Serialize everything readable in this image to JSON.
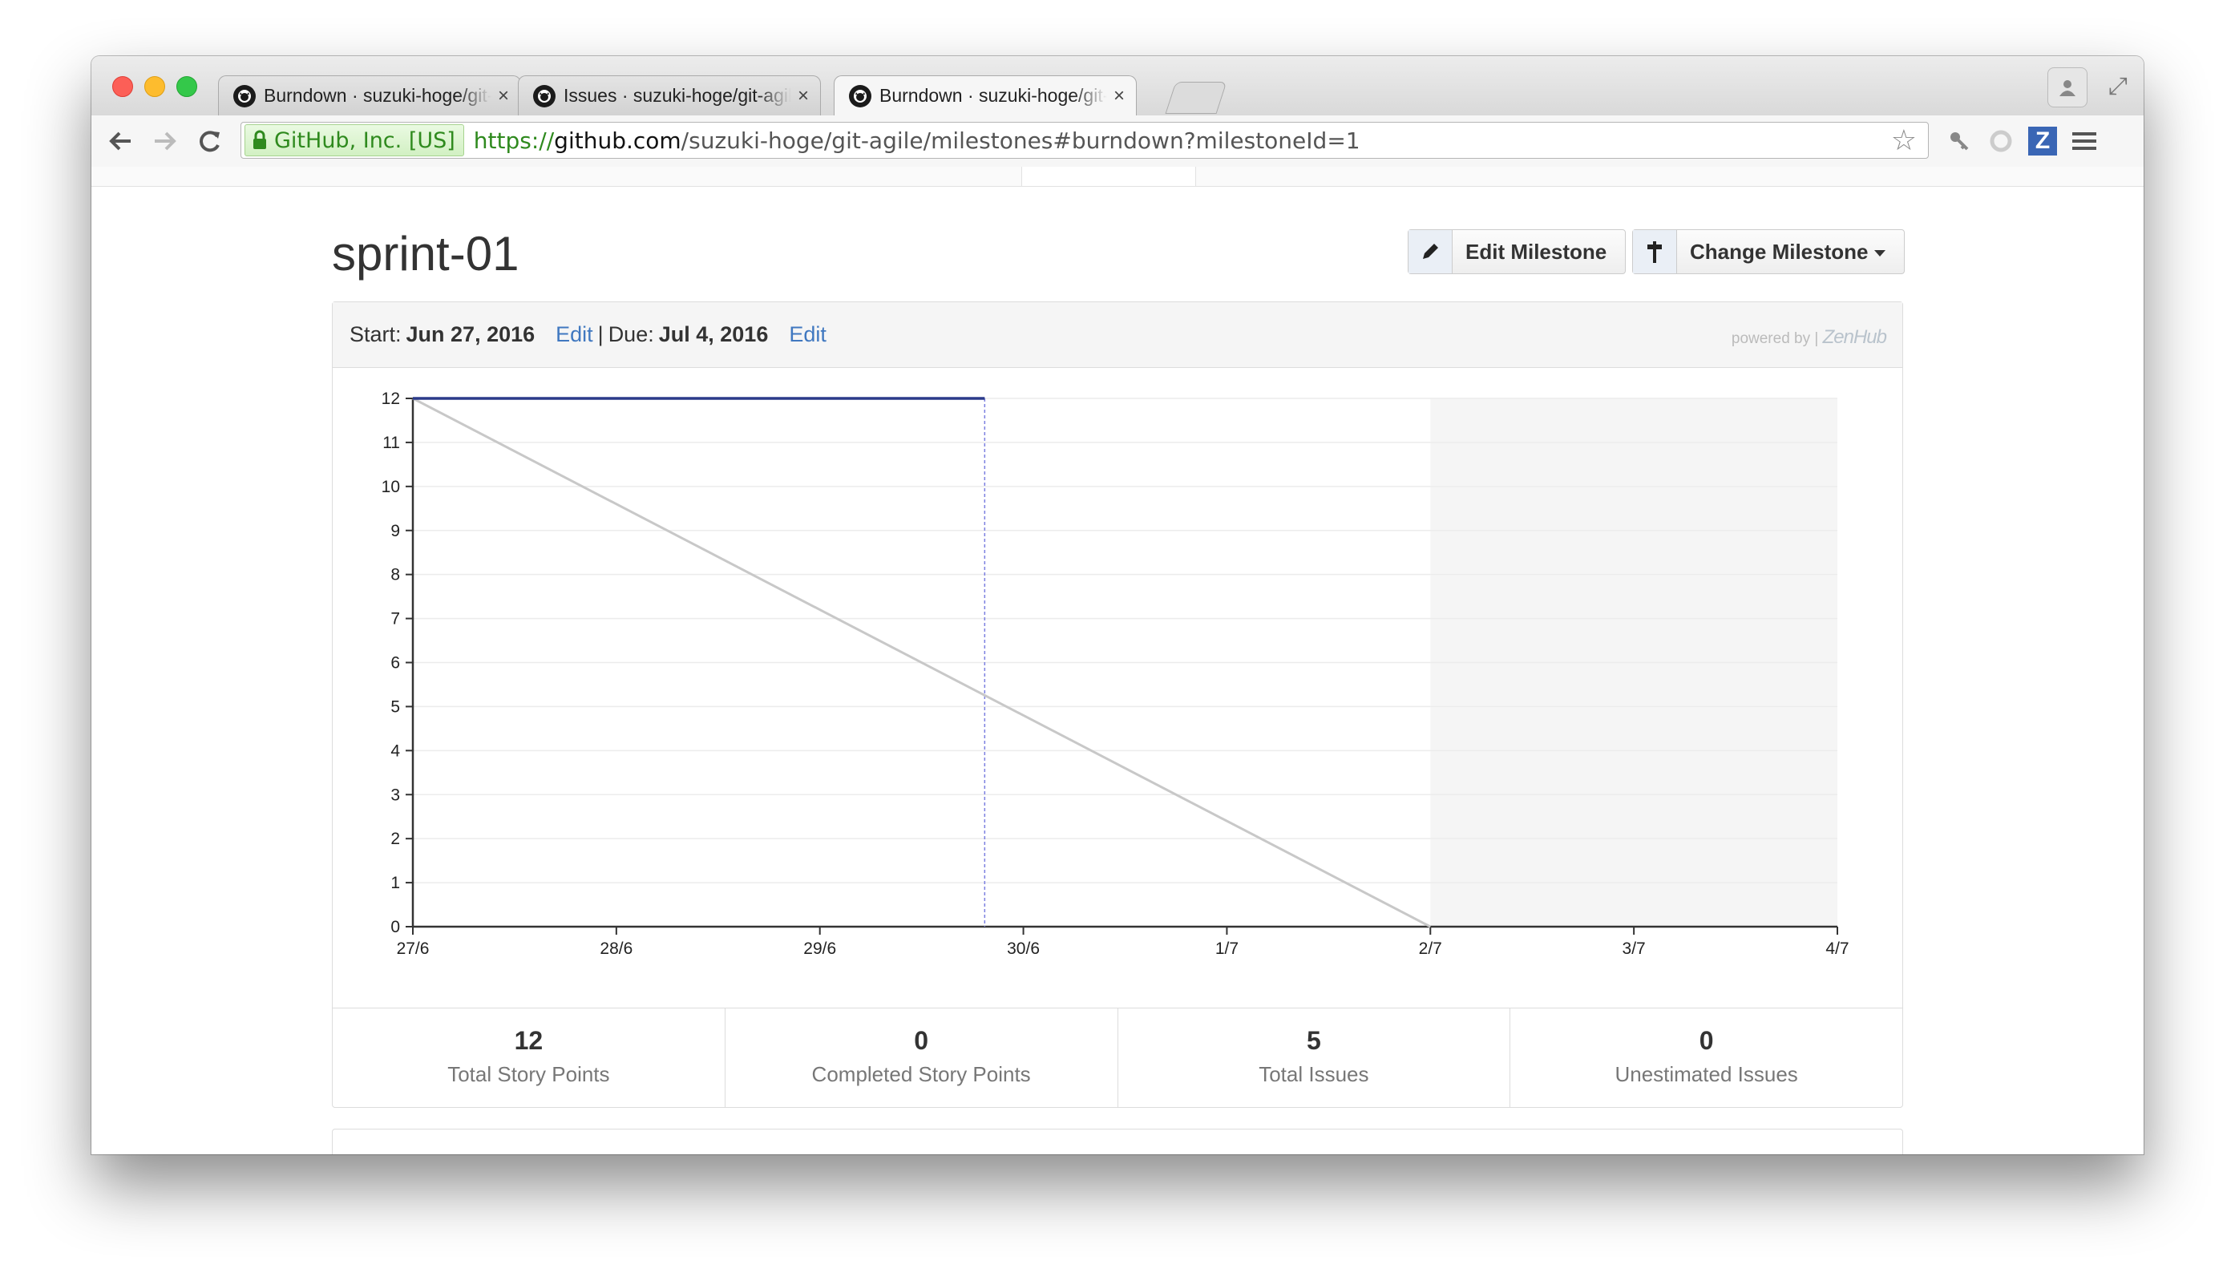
{
  "browser": {
    "tabs": [
      {
        "title": "Burndown · suzuki-hoge/git-agile"
      },
      {
        "title": "Issues · suzuki-hoge/git-agile"
      },
      {
        "title": "Burndown · suzuki-hoge/git-agile",
        "active": true
      }
    ],
    "tab_close": "×",
    "ev_label": "GitHub, Inc. [US]",
    "url_scheme": "https://",
    "url_host": "github.com",
    "url_path": "/suzuki-hoge/git-agile/milestones#burndown?milestoneId=1",
    "ext_z_label": "Z"
  },
  "milestone": {
    "title": "sprint-01",
    "edit_button": "Edit Milestone",
    "change_button": "Change Milestone",
    "start_label": "Start:",
    "start_date": "Jun 27, 2016",
    "due_label": "Due:",
    "due_date": "Jul 4, 2016",
    "edit_link": "Edit",
    "separator": "|",
    "powered_by": "powered by",
    "powered_brand": "ZenHub"
  },
  "stats": [
    {
      "value": "12",
      "label": "Total Story Points"
    },
    {
      "value": "0",
      "label": "Completed Story Points"
    },
    {
      "value": "5",
      "label": "Total Issues"
    },
    {
      "value": "0",
      "label": "Unestimated Issues"
    }
  ],
  "colors": {
    "actual_line": "#2b3a8a",
    "ideal_line": "#c8c8c8",
    "today_line": "#7b7fe0",
    "weekend_shade": "#f5f5f5",
    "link": "#4078c0"
  },
  "chart_data": {
    "type": "line",
    "categories": [
      "27/6",
      "28/6",
      "29/6",
      "30/6",
      "1/7",
      "2/7",
      "3/7",
      "4/7"
    ],
    "y_ticks": [
      "0",
      "1",
      "2",
      "3",
      "4",
      "5",
      "6",
      "7",
      "8",
      "9",
      "10",
      "11",
      "12"
    ],
    "ylim": [
      0,
      12
    ],
    "series": [
      {
        "role": "ideal",
        "points": [
          [
            0,
            12
          ],
          [
            5,
            0
          ]
        ]
      },
      {
        "role": "actual",
        "points": [
          [
            0,
            12
          ],
          [
            2.81,
            12
          ]
        ]
      }
    ],
    "today_x": 2.81,
    "shaded_range": [
      5,
      7
    ],
    "grid": true
  }
}
